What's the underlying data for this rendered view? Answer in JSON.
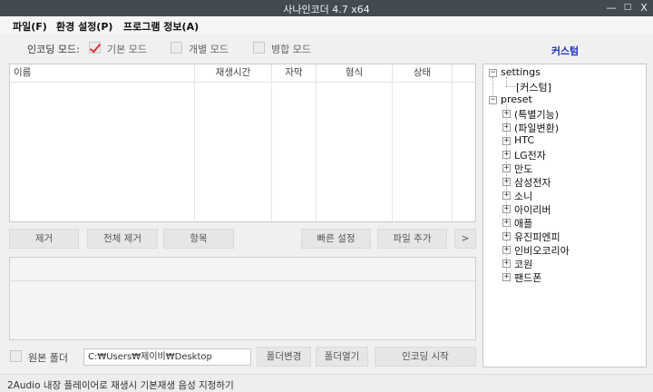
{
  "window": {
    "title": "사나인코더 4.7 x64",
    "min_glyph": "—",
    "max_glyph": "□",
    "close_glyph": "X"
  },
  "menu": [
    "파일(F)",
    "환경 설정(P)",
    "프로그램 정보(A)"
  ],
  "encoding_mode": {
    "label": "인코딩 모드:",
    "options": [
      {
        "label": "기본 모드",
        "checked": true
      },
      {
        "label": "개별 모드",
        "checked": false
      },
      {
        "label": "병합 모드",
        "checked": false
      }
    ]
  },
  "file_table": {
    "columns": [
      "이름",
      "재생시간",
      "자막",
      "형식",
      "상태"
    ],
    "rows": []
  },
  "list_buttons": {
    "remove": "제거",
    "remove_all": "전체 제거",
    "items": "항목",
    "quick_settings": "빠른 설정",
    "add_file": "파일 추가",
    "more": ">"
  },
  "folder": {
    "original_folder_label": "원본 폴더",
    "original_folder_checked": false,
    "path": "C:₩Users₩제이비₩Desktop",
    "change_button": "폴더변경",
    "open_button": "폴더열기",
    "start_button": "인코딩 시작"
  },
  "preset_panel": {
    "title": "커스텀",
    "tree": {
      "settings": {
        "label": "settings",
        "children": [
          "[커스텀]"
        ]
      },
      "preset": {
        "label": "preset",
        "children": [
          "(특별기능)",
          "(파일변환)",
          "HTC",
          "LG전자",
          "만도",
          "삼성전자",
          "소니",
          "아이리버",
          "애플",
          "유진피엔피",
          "인비오코리아",
          "코원",
          "팬드폰"
        ]
      }
    }
  },
  "status": "2Audio 내장 플레이어로 재생시 기본재생 음성 지정하기",
  "colors": {
    "titlebar": "#424a52",
    "check_mark": "#e0303c",
    "panel_title": "#1c2fc8"
  }
}
